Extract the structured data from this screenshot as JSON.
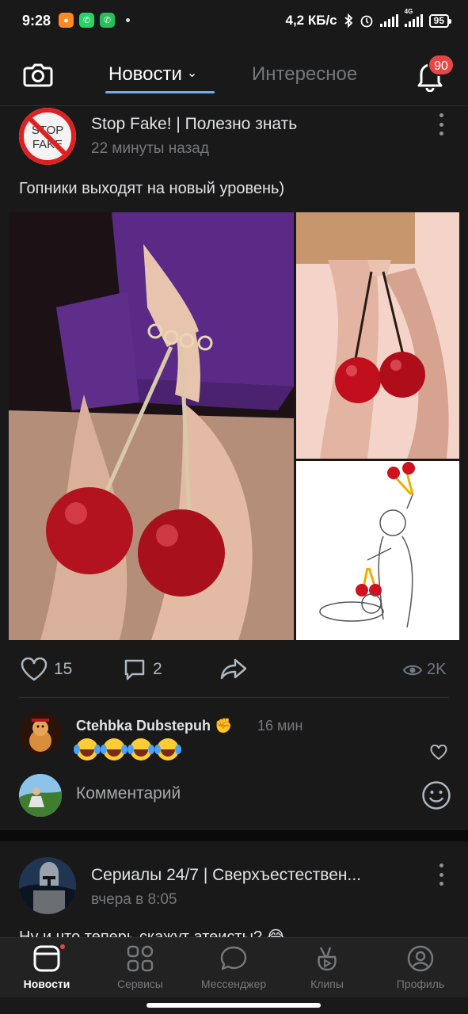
{
  "status_bar": {
    "time": "9:28",
    "network_speed": "4,2 КБ/с",
    "network_type": "4G",
    "battery": "95"
  },
  "header": {
    "tab_news": "Новости",
    "tab_interesting": "Интересное",
    "notifications_count": "90",
    "accent_color": "#71aaeb"
  },
  "post1": {
    "author": "Stop Fake! | Полезно знать",
    "time": "22 минуты назад",
    "text": "Гопники выходят на новый уровень)",
    "avatar_text_top": "STOP",
    "avatar_text_bottom": "FAKE",
    "likes": "15",
    "comments": "2",
    "views": "2K",
    "comment": {
      "author": "Ctehbka Dubstepuh",
      "time": "16 мин",
      "emoji_count": 4
    },
    "comment_placeholder": "Комментарий"
  },
  "post2": {
    "author": "Сериалы 24/7 | Сверхъестествен...",
    "time": "вчера в 8:05",
    "text_peek": "Ну и что теперь скажут атеисты? 😂"
  },
  "bottom_nav": {
    "items": [
      {
        "label": "Новости",
        "icon": "news-icon"
      },
      {
        "label": "Сервисы",
        "icon": "services-icon"
      },
      {
        "label": "Мессенджер",
        "icon": "messenger-icon"
      },
      {
        "label": "Клипы",
        "icon": "clips-icon"
      },
      {
        "label": "Профиль",
        "icon": "profile-icon"
      }
    ]
  }
}
